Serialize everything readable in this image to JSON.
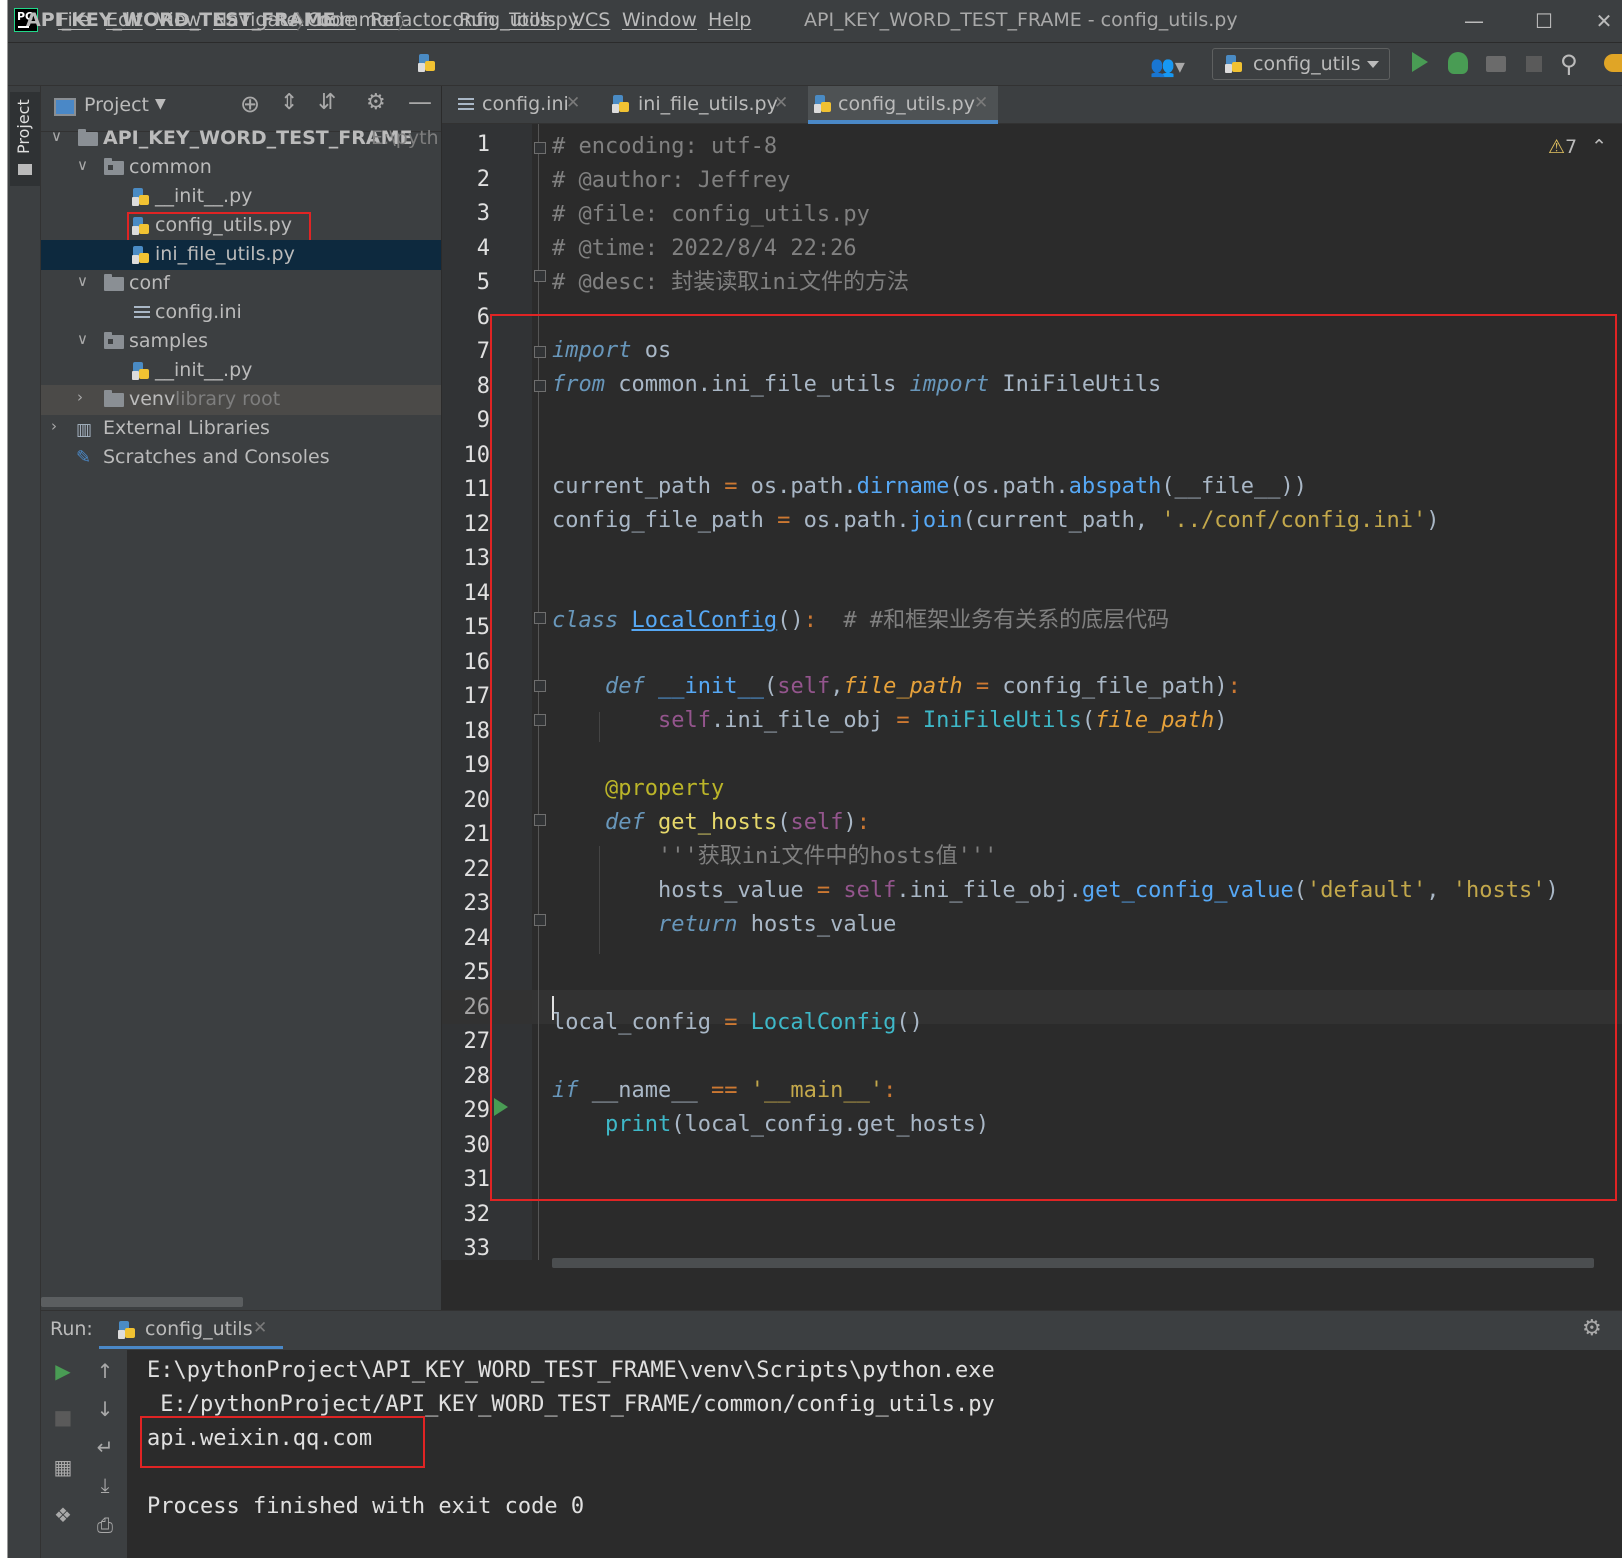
{
  "menu": [
    "File",
    "Edit",
    "View",
    "Navigate",
    "Code",
    "Refactor",
    "Run",
    "Tools",
    "VCS",
    "Window",
    "Help"
  ],
  "window_title": "API_KEY_WORD_TEST_FRAME - config_utils.py",
  "logo_text": "PC",
  "breadcrumb": [
    "API_KEY_WORD_TEST_FRAME",
    "common",
    "config_utils.py"
  ],
  "run_config": "config_utils",
  "stripe_label": "Project",
  "project": {
    "title": "Project",
    "root": "API_KEY_WORD_TEST_FRAME",
    "root_path": "E:\\pyth",
    "tree": [
      {
        "label": "common"
      },
      {
        "label": "__init__.py"
      },
      {
        "label": "config_utils.py"
      },
      {
        "label": "ini_file_utils.py"
      },
      {
        "label": "conf"
      },
      {
        "label": "config.ini"
      },
      {
        "label": "samples"
      },
      {
        "label": "__init__.py"
      },
      {
        "label": "venv",
        "suffix": "library root"
      },
      {
        "label": "External Libraries"
      },
      {
        "label": "Scratches and Consoles"
      }
    ]
  },
  "tabs": [
    "config.ini",
    "ini_file_utils.py",
    "config_utils.py"
  ],
  "active_tab": "config_utils.py",
  "warnings": "7",
  "line_numbers": [
    "1",
    "2",
    "3",
    "4",
    "5",
    "6",
    "7",
    "8",
    "9",
    "10",
    "11",
    "12",
    "13",
    "14",
    "15",
    "16",
    "17",
    "18",
    "19",
    "20",
    "21",
    "22",
    "23",
    "24",
    "25",
    "26",
    "27",
    "28",
    "29",
    "30",
    "31",
    "32",
    "33"
  ],
  "code": {
    "l1": "# encoding: utf-8",
    "l2": "# @author: Jeffrey",
    "l3": "# @file: config_utils.py",
    "l4": "# @time: 2022/8/4 22:26",
    "l5": "# @desc: 封装读取ini文件的方法",
    "l7_kw": "import",
    "l7_rest": " os",
    "l8_kw": "from",
    "l8_mod": " common.ini_file_utils ",
    "l8_kw2": "import",
    "l8_rest": " IniFileUtils",
    "l11_a": "current_path ",
    "l11_op": "=",
    "l11_b": " os.path.",
    "l11_fn": "dirname",
    "l11_c": "(os.path.",
    "l11_fn2": "abspath",
    "l11_d": "(__file__))",
    "l12_a": "config_file_path ",
    "l12_op": "=",
    "l12_b": " os.path.",
    "l12_fn": "join",
    "l12_c": "(current_path, ",
    "l12_str": "'../conf/config.ini'",
    "l12_d": ")",
    "l15_kw": "class",
    "l15_cls": "LocalConfig",
    "l15_paren": "()",
    "l15_colon": ":",
    "l15_com": "  # #和框架业务有关系的底层代码",
    "l17_kw": "def",
    "l17_fn": "__init__",
    "l17_p1": "(",
    "l17_self": "self",
    "l17_comma": ",",
    "l17_param": "file_path",
    "l17_eq": " = ",
    "l17_rest": "config_file_path)",
    "l17_colon": ":",
    "l18_self": "self",
    "l18_a": ".ini_file_obj ",
    "l18_op": "=",
    "l18_fn": " IniFileUtils",
    "l18_p": "(",
    "l18_param": "file_path",
    "l18_e": ")",
    "l20_deco": "@property",
    "l21_kw": "def",
    "l21_fn": "get_hosts",
    "l21_p": "(",
    "l21_self": "self",
    "l21_e": ")",
    "l21_colon": ":",
    "l22_doc": "'''获取ini文件中的hosts值'''",
    "l23_a": "hosts_value ",
    "l23_op": "=",
    "l23_self": " self",
    "l23_b": ".ini_file_obj.",
    "l23_fn": "get_config_value",
    "l23_c": "(",
    "l23_s1": "'default'",
    "l23_comma": ", ",
    "l23_s2": "'hosts'",
    "l23_d": ")",
    "l24_kw": "return",
    "l24_rest": " hosts_value",
    "l27_a": "local_config ",
    "l27_op": "=",
    "l27_fn": " LocalConfig",
    "l27_b": "()",
    "l29_kw": "if",
    "l29_a": " __name__ ",
    "l29_op": "==",
    "l29_str": " '__main__'",
    "l29_colon": ":",
    "l30_fn": "print",
    "l30_rest": "(local_config.get_hosts)"
  },
  "run": {
    "label": "Run:",
    "tab": "config_utils",
    "lines": [
      "E:\\pythonProject\\API_KEY_WORD_TEST_FRAME\\venv\\Scripts\\python.exe",
      " E:/pythonProject/API_KEY_WORD_TEST_FRAME/common/config_utils.py",
      "api.weixin.qq.com",
      "",
      "Process finished with exit code 0"
    ]
  },
  "colors": {
    "accent": "#4a88c7",
    "highlight_box": "#e02424",
    "run_green": "#499c54"
  }
}
